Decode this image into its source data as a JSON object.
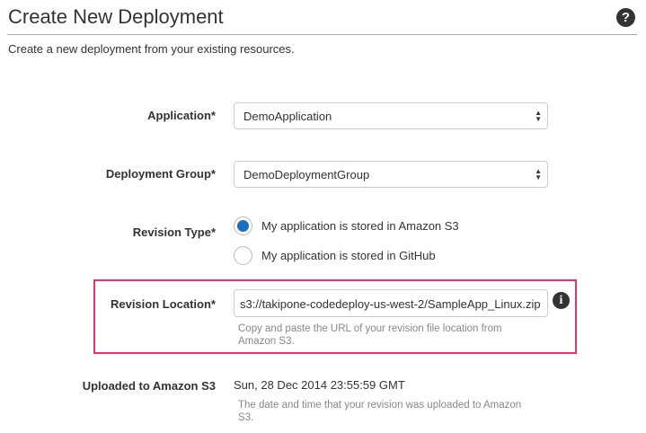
{
  "header": {
    "title": "Create New Deployment",
    "subtitle": "Create a new deployment from your existing resources.",
    "help_icon": "?"
  },
  "form": {
    "application": {
      "label": "Application*",
      "value": "DemoApplication"
    },
    "deployment_group": {
      "label": "Deployment Group*",
      "value": "DemoDeploymentGroup"
    },
    "revision_type": {
      "label": "Revision Type*",
      "options": [
        "My application is stored in Amazon S3",
        "My application is stored in GitHub"
      ],
      "selected": 0
    },
    "revision_location": {
      "label": "Revision Location*",
      "value": "s3://takipone-codedeploy-us-west-2/SampleApp_Linux.zip",
      "hint": "Copy and paste the URL of your revision file location from Amazon S3.",
      "info_icon": "i"
    },
    "uploaded": {
      "label": "Uploaded to Amazon S3",
      "value": "Sun, 28 Dec 2014 23:55:59 GMT",
      "hint": "The date and time that your revision was uploaded to Amazon S3."
    }
  },
  "colors": {
    "highlight": "#ef2f6b",
    "radio": "#1a6fc4"
  }
}
